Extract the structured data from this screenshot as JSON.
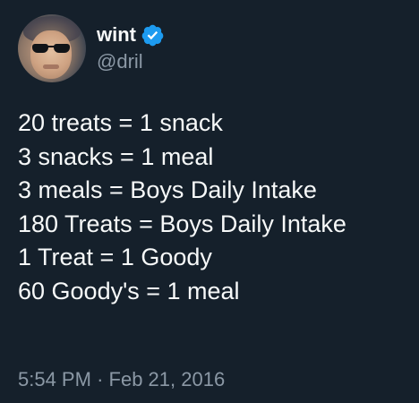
{
  "author": {
    "display_name": "wint",
    "handle": "@dril",
    "verified": true,
    "verified_badge_color": "#1d9bf0",
    "avatar_icon": "profile-avatar"
  },
  "tweet": {
    "lines": [
      "20 treats = 1 snack",
      "3 snacks = 1 meal",
      "3 meals = Boys Daily Intake",
      "180 Treats = Boys Daily Intake",
      "1 Treat = 1 Goody",
      "60 Goody's = 1 meal"
    ],
    "time": "5:54 PM",
    "separator": "·",
    "date": "Feb 21, 2016"
  },
  "colors": {
    "background": "#15202b",
    "primary_text": "#f7f9f9",
    "secondary_text": "#8b98a5"
  }
}
